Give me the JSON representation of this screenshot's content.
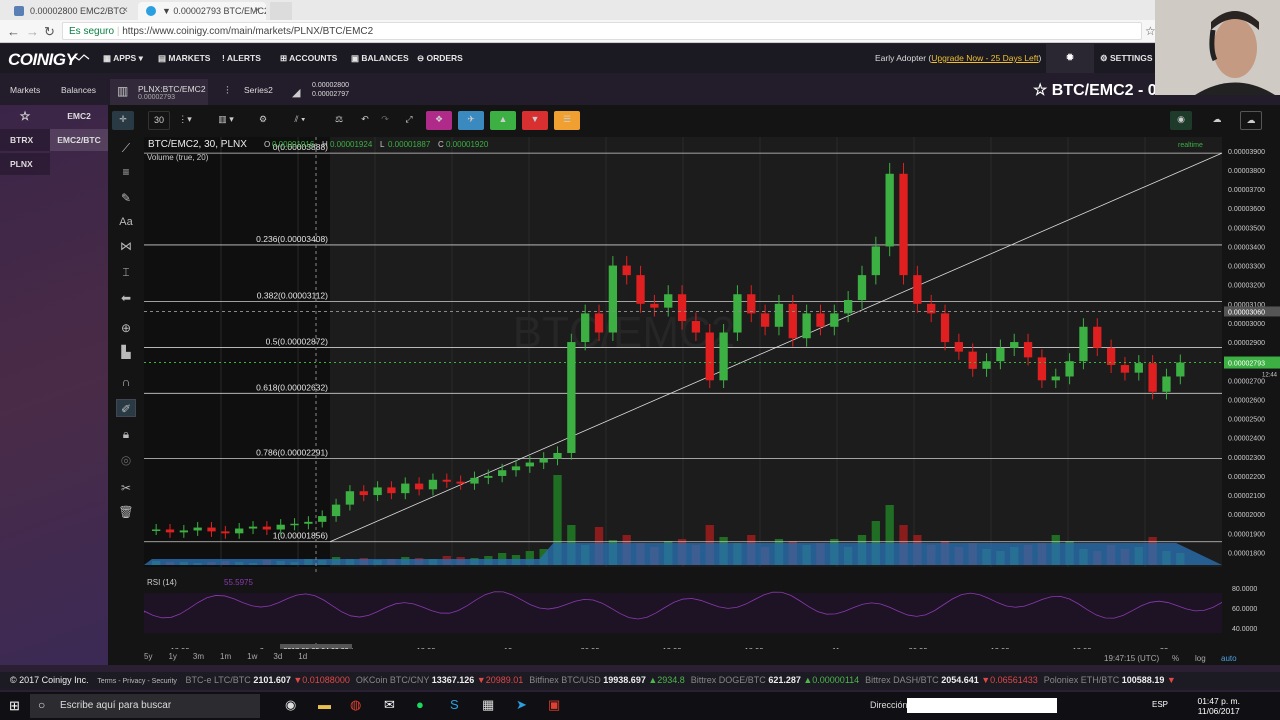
{
  "browser": {
    "tabs": [
      {
        "title": "0.00002800 EMC2/BTC"
      },
      {
        "title": "▼ 0.00002793 BTC/EMC2"
      }
    ],
    "secure_label": "Es seguro",
    "url": "https://www.coinigy.com/main/markets/PLNX/BTC/EMC2"
  },
  "topnav": {
    "logo": "COINIGY",
    "items": [
      "APPS",
      "MARKETS",
      "ALERTS",
      "ACCOUNTS",
      "BALANCES",
      "ORDERS"
    ],
    "early_adopter_prefix": "Early Adopter (",
    "upgrade_link": "Upgrade Now - 25 Days Left",
    "early_adopter_suffix": ")",
    "settings": "SETTINGS"
  },
  "subbar": {
    "tab_markets": "Markets",
    "tab_balances": "Balances",
    "chart_tab_name": "PLNX:BTC/EMC2",
    "chart_tab_value": "0.00002793",
    "series_label": "Series2",
    "depth_top": "0.00002800",
    "depth_bottom": "0.00002797",
    "pair_title": "BTC/EMC2 - 0.00002793"
  },
  "leftpanel": {
    "rows": [
      {
        "left": "☆",
        "right": "EMC2"
      },
      {
        "left": "BTRX",
        "right": "EMC2/BTC"
      },
      {
        "left": "PLNX",
        "right": ""
      }
    ]
  },
  "toolbar": {
    "interval": "30"
  },
  "chart_header": {
    "symbol": "BTC/EMC2, 30, PLNX",
    "ohlc": [
      {
        "k": "O",
        "v": "0.00001916"
      },
      {
        "k": "H",
        "v": "0.00001924"
      },
      {
        "k": "L",
        "v": "0.00001887"
      },
      {
        "k": "C",
        "v": "0.00001920"
      }
    ],
    "volume_label": "Volume (true, 20)",
    "realtime": "realtime",
    "watermark": "BTC/EMC2"
  },
  "chart_data": {
    "type": "candlestick",
    "fibonacci": [
      {
        "level": "0",
        "value": 3.888e-05
      },
      {
        "level": "0.236",
        "value": 3.408e-05
      },
      {
        "level": "0.382",
        "value": 3.112e-05
      },
      {
        "level": "0.5",
        "value": 2.872e-05
      },
      {
        "level": "0.618",
        "value": 2.632e-05
      },
      {
        "level": "0.786",
        "value": 2.291e-05
      },
      {
        "level": "1",
        "value": 1.856e-05
      }
    ],
    "fib_labels": [
      "0(0.00003888)",
      "0.236(0.00003408)",
      "0.382(0.00003112)",
      "0.5(0.00002872)",
      "0.618(0.00002632)",
      "0.786(0.00002291)",
      "1(0.00001856)"
    ],
    "price_ticks": [
      "0.00003900",
      "0.00003800",
      "0.00003700",
      "0.00003600",
      "0.00003500",
      "0.00003400",
      "0.00003300",
      "0.00003200",
      "0.00003100",
      "0.00003000",
      "0.00002900",
      "0.00002800",
      "0.00002700",
      "0.00002600",
      "0.00002500",
      "0.00002400",
      "0.00002300",
      "0.00002200",
      "0.00002100",
      "0.00002000",
      "0.00001900",
      "0.00001800"
    ],
    "ylim": [
      1.75e-05,
      3.92e-05
    ],
    "current_price": "0.00002793",
    "crosshair_price": "0.00003060",
    "countdown": "12:44",
    "time_ticks": [
      "18:00",
      "9",
      "12:00",
      "18:00",
      "10",
      "06:00",
      "12:00",
      "18:00",
      "11",
      "06:00",
      "12:00",
      "18:00",
      "22"
    ],
    "crosshair_time": "2017-06-09 04:00:00",
    "close_series": [
      1920,
      1905,
      1915,
      1930,
      1910,
      1900,
      1925,
      1935,
      1920,
      1945,
      1950,
      1960,
      1990,
      2050,
      2120,
      2100,
      2140,
      2110,
      2160,
      2130,
      2180,
      2170,
      2160,
      2190,
      2200,
      2230,
      2250,
      2270,
      2290,
      2320,
      2900,
      3050,
      2950,
      3300,
      3250,
      3100,
      3080,
      3150,
      3010,
      2950,
      2700,
      2950,
      3150,
      3050,
      2980,
      3100,
      2920,
      3050,
      2980,
      3050,
      3120,
      3250,
      3400,
      3780,
      3250,
      3100,
      3050,
      2900,
      2850,
      2760,
      2800,
      2870,
      2900,
      2820,
      2700,
      2720,
      2800,
      2980,
      2870,
      2780,
      2740,
      2790,
      2640,
      2720,
      2793
    ],
    "rsi_label": "RSI (14)",
    "rsi_value": "55.5975",
    "rsi_ticks": [
      "80.0000",
      "60.0000",
      "40.0000"
    ]
  },
  "bottom": {
    "timeframes": [
      "5y",
      "1y",
      "3m",
      "1m",
      "1w",
      "3d",
      "1d"
    ],
    "clock_utc": "19:47:15 (UTC)",
    "options": [
      "%",
      "log",
      "auto"
    ]
  },
  "ticker": {
    "copyright": "© 2017 Coinigy Inc.",
    "links": "Terms - Privacy - Security",
    "items": [
      {
        "name": "BTC-e LTC/BTC",
        "v1": "2101.607",
        "v2": "0.01088000",
        "dir": "dn"
      },
      {
        "name": "OKCoin BTC/CNY",
        "v1": "13367.126",
        "v2": "20989.01",
        "dir": "dn"
      },
      {
        "name": "Bitfinex BTC/USD",
        "v1": "19938.697",
        "v2": "2934.8",
        "dir": "up"
      },
      {
        "name": "Bittrex DOGE/BTC",
        "v1": "621.287",
        "v2": "0.00000114",
        "dir": "up"
      },
      {
        "name": "Bittrex DASH/BTC",
        "v1": "2054.641",
        "v2": "0.06561433",
        "dir": "dn"
      },
      {
        "name": "Poloniex ETH/BTC",
        "v1": "100588.19",
        "v2": "",
        "dir": "dn"
      }
    ]
  },
  "taskbar": {
    "search_placeholder": "Escribe aquí para buscar",
    "address_label": "Dirección",
    "lang": "ESP",
    "time": "01:47 p. m.",
    "date": "11/06/2017"
  },
  "colors": {
    "up": "#3cb043",
    "down": "#e02020",
    "accent": "#f0c030"
  }
}
